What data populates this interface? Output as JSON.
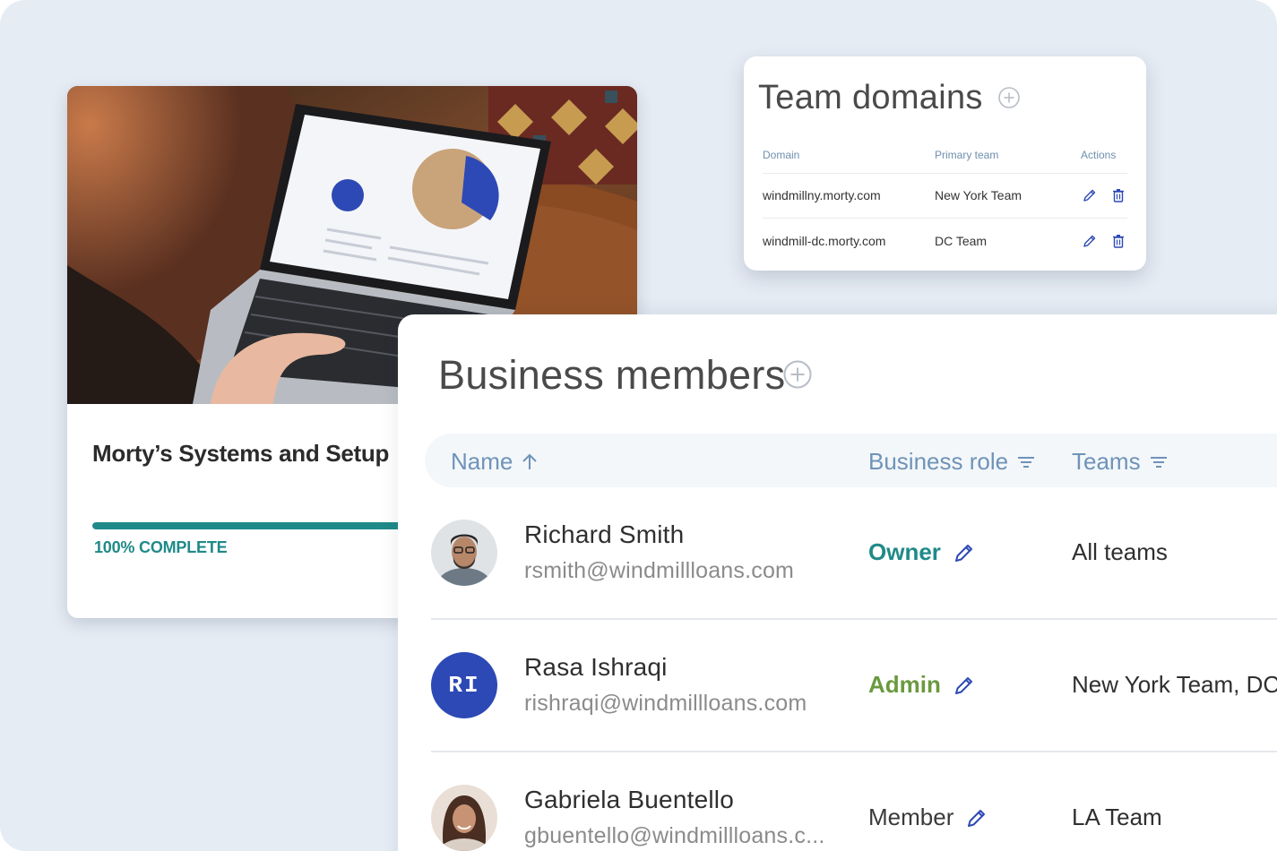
{
  "course": {
    "title": "Morty’s Systems and Setup",
    "progress_percent": 100,
    "progress_label": "100% COMPLETE",
    "photo_description_icon": "laptop-photo",
    "brand_color": "#1f8a88"
  },
  "team_domains": {
    "title": "Team domains",
    "add_icon": "plus-circle-icon",
    "columns": [
      "Domain",
      "Primary team",
      "Actions"
    ],
    "rows": [
      {
        "domain": "windmillny.morty.com",
        "primary_team": "New York Team"
      },
      {
        "domain": "windmill-dc.morty.com",
        "primary_team": "DC Team"
      }
    ],
    "action_icons": [
      "pencil-icon",
      "trash-icon"
    ],
    "action_color": "#2d49b5"
  },
  "business_members": {
    "title": "Business members",
    "add_icon": "plus-circle-icon",
    "columns": {
      "name": "Name",
      "role": "Business role",
      "teams": "Teams"
    },
    "header_icons": {
      "name": "arrow-up-icon",
      "role": "filter-icon",
      "teams": "filter-icon"
    },
    "members": [
      {
        "name": "Richard Smith",
        "email": "rsmith@windmillloans.com",
        "role": "Owner",
        "teams": "All teams",
        "avatar": "photo"
      },
      {
        "name": "Rasa Ishraqi",
        "email": "rishraqi@windmillloans.com",
        "role": "Admin",
        "teams": "New York Team, DC T",
        "avatar": "initials",
        "initials": "RI"
      },
      {
        "name": "Gabriela Buentello",
        "email": "gbuentello@windmillloans.c...",
        "role": "Member",
        "teams": "LA Team",
        "avatar": "photo"
      }
    ],
    "colors": {
      "owner": "#1f8a88",
      "admin": "#6a9a3e",
      "header_text": "#6f93b8",
      "avatar_initials_bg": "#2d49b5",
      "edit_icon": "#2d49b5"
    }
  }
}
